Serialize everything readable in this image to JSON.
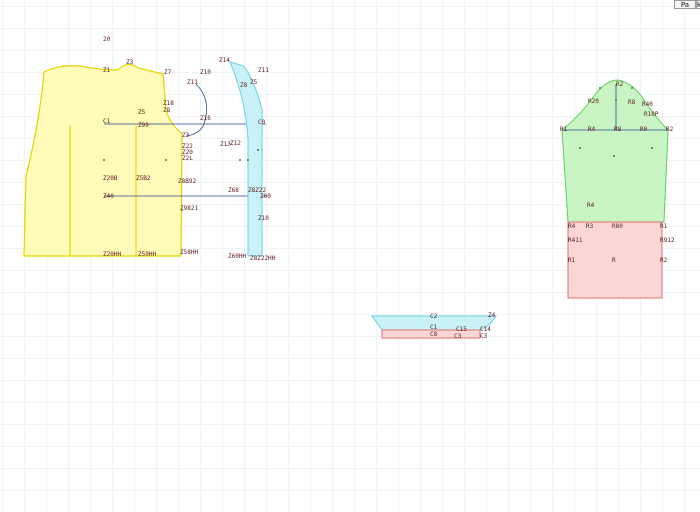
{
  "toolbar": {
    "pa_label": "Pa",
    "more_label": "k"
  },
  "colors": {
    "grid": "#dfe8ef",
    "bodice": "#fffbb8",
    "bodice_stroke": "#e7d200",
    "facing": "#c8f2f7",
    "facing_stroke": "#6fcfdd",
    "sleeve_top": "#c9f5c4",
    "sleeve_top_stroke": "#5fcf59",
    "sleeve_bottom": "#fbd6d6",
    "sleeve_bottom_stroke": "#e07070",
    "collar_top": "#c8f2f7",
    "collar_bottom": "#fbd6d6"
  },
  "pieces": {
    "bodice": {
      "labels": [
        "20",
        "Z1",
        "Z3",
        "Z7",
        "Z5",
        "C1",
        "Z99",
        "Z8",
        "Z18",
        "Z3",
        "Z22",
        "Z20",
        "Z2L",
        "Z20B",
        "Z5B2",
        "Z8B92",
        "Z40",
        "Z9821",
        "Z20HH",
        "Z59HH",
        "Z58HH"
      ]
    },
    "facing": {
      "labels": [
        "Z14",
        "Z11",
        "Z10",
        "Z11",
        "Z5",
        "Z16",
        "Z8",
        "C0",
        "Z13",
        "Z12",
        "Z68",
        "Z8Z22",
        "Z00",
        "Z10",
        "Z60HH",
        "Z8Z22HH"
      ]
    },
    "sleeve": {
      "labels": [
        "R2",
        "R20",
        "R8",
        "R40",
        "R10P",
        "R1",
        "R4",
        "R8",
        "R0",
        "R2",
        "R4",
        "R3",
        "R4",
        "R80",
        "R1",
        "R411",
        "R912",
        "R2",
        "R1",
        "R"
      ]
    },
    "collar": {
      "labels": [
        "C2",
        "Z4",
        "C1",
        "C15",
        "C14",
        "C8",
        "C3",
        "C3"
      ]
    }
  }
}
